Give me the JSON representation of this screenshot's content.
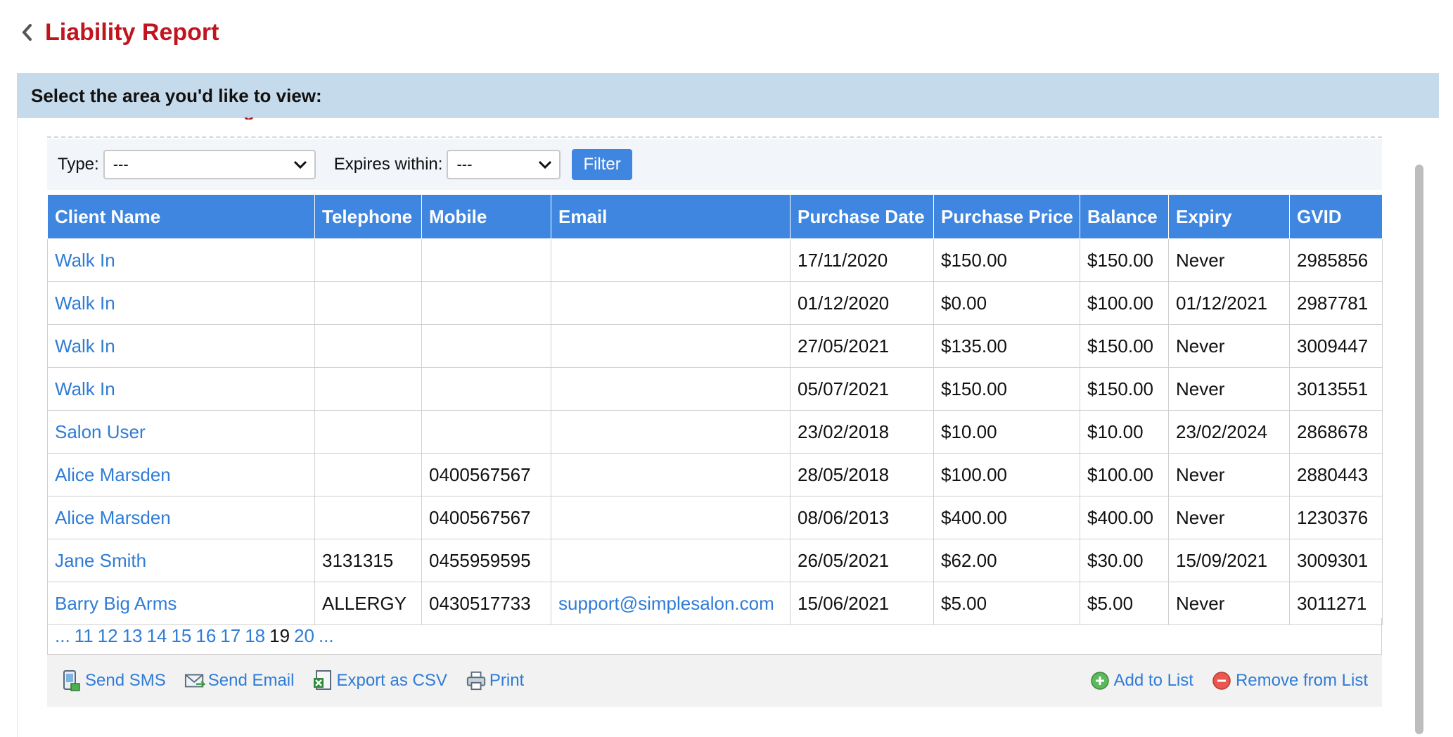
{
  "header": {
    "title": "Liability Report"
  },
  "banner": {
    "text": "Select the area you'd like to view:"
  },
  "filters": {
    "type_label": "Type:",
    "type_value": "---",
    "expires_label": "Expires within:",
    "expires_value": "---",
    "filter_button": "Filter"
  },
  "table": {
    "columns": [
      "Client Name",
      "Telephone",
      "Mobile",
      "Email",
      "Purchase Date",
      "Purchase Price",
      "Balance",
      "Expiry",
      "GVID"
    ],
    "rows": [
      [
        "Walk In",
        "",
        "",
        "",
        "17/11/2020",
        "$150.00",
        "$150.00",
        "Never",
        "2985856"
      ],
      [
        "Walk In",
        "",
        "",
        "",
        "01/12/2020",
        "$0.00",
        "$100.00",
        "01/12/2021",
        "2987781"
      ],
      [
        "Walk In",
        "",
        "",
        "",
        "27/05/2021",
        "$135.00",
        "$150.00",
        "Never",
        "3009447"
      ],
      [
        "Walk In",
        "",
        "",
        "",
        "05/07/2021",
        "$150.00",
        "$150.00",
        "Never",
        "3013551"
      ],
      [
        "Salon User",
        "",
        "",
        "",
        "23/02/2018",
        "$10.00",
        "$10.00",
        "23/02/2024",
        "2868678"
      ],
      [
        "Alice Marsden",
        "",
        "0400567567",
        "",
        "28/05/2018",
        "$100.00",
        "$100.00",
        "Never",
        "2880443"
      ],
      [
        "Alice Marsden",
        "",
        "0400567567",
        "",
        "08/06/2013",
        "$400.00",
        "$400.00",
        "Never",
        "1230376"
      ],
      [
        "Jane Smith",
        "3131315",
        "0455959595",
        "",
        "26/05/2021",
        "$62.00",
        "$30.00",
        "15/09/2021",
        "3009301"
      ],
      [
        "Barry Big Arms",
        "ALLERGY",
        "0430517733",
        "support@simplesalon.com",
        "15/06/2021",
        "$5.00",
        "$5.00",
        "Never",
        "3011271"
      ]
    ]
  },
  "pagination": {
    "prev": "...",
    "pages": [
      "11",
      "12",
      "13",
      "14",
      "15",
      "16",
      "17",
      "18",
      "19",
      "20"
    ],
    "current": "19",
    "next": "..."
  },
  "actions": {
    "send_sms": "Send SMS",
    "send_email": "Send Email",
    "export_csv": "Export as CSV",
    "print": "Print",
    "add_to_list": "Add to List",
    "remove_from_list": "Remove from List"
  },
  "colors": {
    "title_red": "#c0151f",
    "header_blue": "#3f86e0",
    "link_blue": "#2f7cd6",
    "banner_bg": "#c5daea"
  },
  "icons": [
    "back-chevron-icon",
    "dropdown-chevron-icon",
    "sms-icon",
    "email-icon",
    "csv-icon",
    "printer-icon",
    "add-circle-icon",
    "remove-circle-icon"
  ]
}
